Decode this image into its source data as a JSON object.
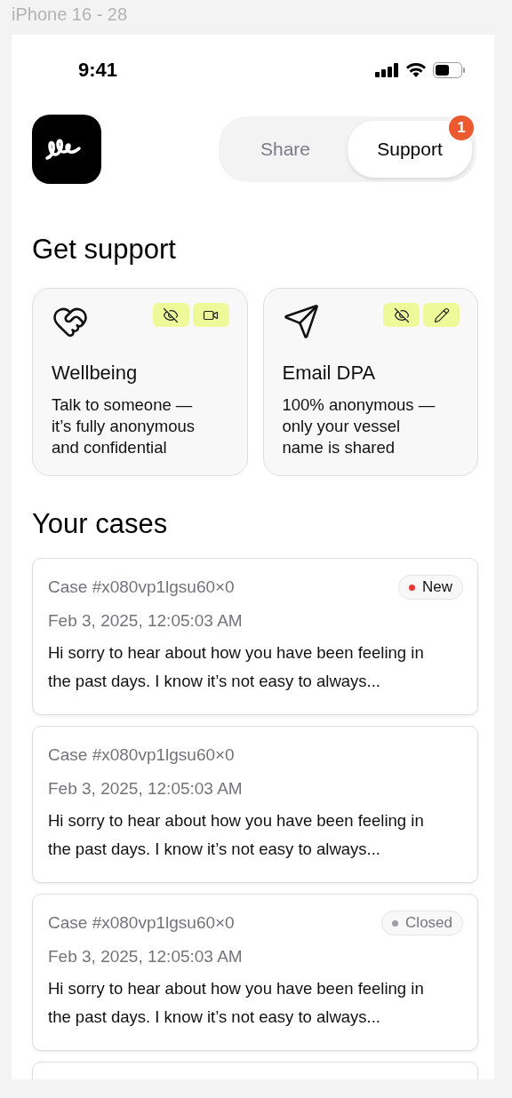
{
  "canvas_label": "iPhone 16 - 28",
  "status_bar": {
    "time": "9:41"
  },
  "tabs": [
    {
      "label": "Share",
      "selected": false
    },
    {
      "label": "Support",
      "selected": true,
      "badge": "1"
    }
  ],
  "support_heading": "Get support",
  "support_options": [
    {
      "kind": "call",
      "title": "Wellbeing",
      "description": "Talk to someone — it’s fully anonymous and confidential"
    },
    {
      "kind": "email",
      "title": "Email DPA",
      "description": "100% anonymous — only your vessel name is shared"
    }
  ],
  "cases_heading": "Your cases",
  "cases": [
    {
      "id": "Case #x080vp1lgsu60×0",
      "status": {
        "kind": "new",
        "label": "New",
        "color": "#e53935"
      },
      "date": "Feb 3, 2025, 12:05:03 AM",
      "message": "Hi sorry to hear about how you have been feeling in the past days. I know it’s not easy to always..."
    },
    {
      "id": "Case #x080vp1lgsu60×0",
      "date": "Feb 3, 2025, 12:05:03 AM",
      "message": "Hi sorry to hear about how you have been feeling in the past days. I know it’s not easy to always..."
    },
    {
      "id": "Case #x080vp1lgsu60×0",
      "status": {
        "kind": "closed",
        "label": "Closed",
        "color": "#9e9ea4"
      },
      "date": "Feb 3, 2025, 12:05:03 AM",
      "message": "Hi sorry to hear about how you have been feeling in the past days. I know it’s not easy to always..."
    }
  ]
}
